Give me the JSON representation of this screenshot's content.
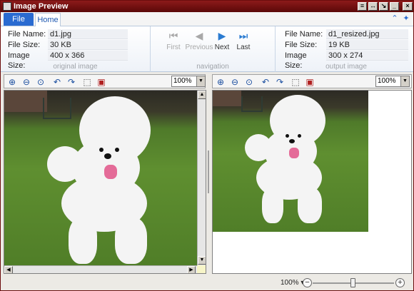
{
  "window": {
    "title": "Image Preview"
  },
  "tabs": {
    "file_label": "File",
    "home_label": "Home"
  },
  "original": {
    "caption": "original image",
    "rows": [
      {
        "label": "File Name:",
        "value": "d1.jpg"
      },
      {
        "label": "File Size:",
        "value": "30 KB"
      },
      {
        "label": "Image Size:",
        "value": "400 x 366"
      }
    ]
  },
  "navigation": {
    "caption": "navigation",
    "first": "First",
    "previous": "Previous",
    "next": "Next",
    "last": "Last"
  },
  "output": {
    "caption": "output image",
    "rows": [
      {
        "label": "File Name:",
        "value": "d1_resized.jpg"
      },
      {
        "label": "File Size:",
        "value": "19 KB"
      },
      {
        "label": "Image Size:",
        "value": "300 x 274"
      }
    ]
  },
  "left_toolbar": {
    "zoom": "100%"
  },
  "right_toolbar": {
    "zoom": "100%"
  },
  "status": {
    "zoom": "100%",
    "zoom_level_fraction": 0.5
  },
  "colors": {
    "accent": "#2a6bd1",
    "title_bar": "#6b0d0d"
  },
  "icons": {
    "zoom_in": "zoom-in-icon",
    "zoom_out": "zoom-out-icon",
    "zoom_fit": "zoom-fit-icon",
    "rotate_left": "rotate-left-icon",
    "rotate_right": "rotate-right-icon",
    "select": "selection-icon",
    "crop": "crop-icon"
  }
}
